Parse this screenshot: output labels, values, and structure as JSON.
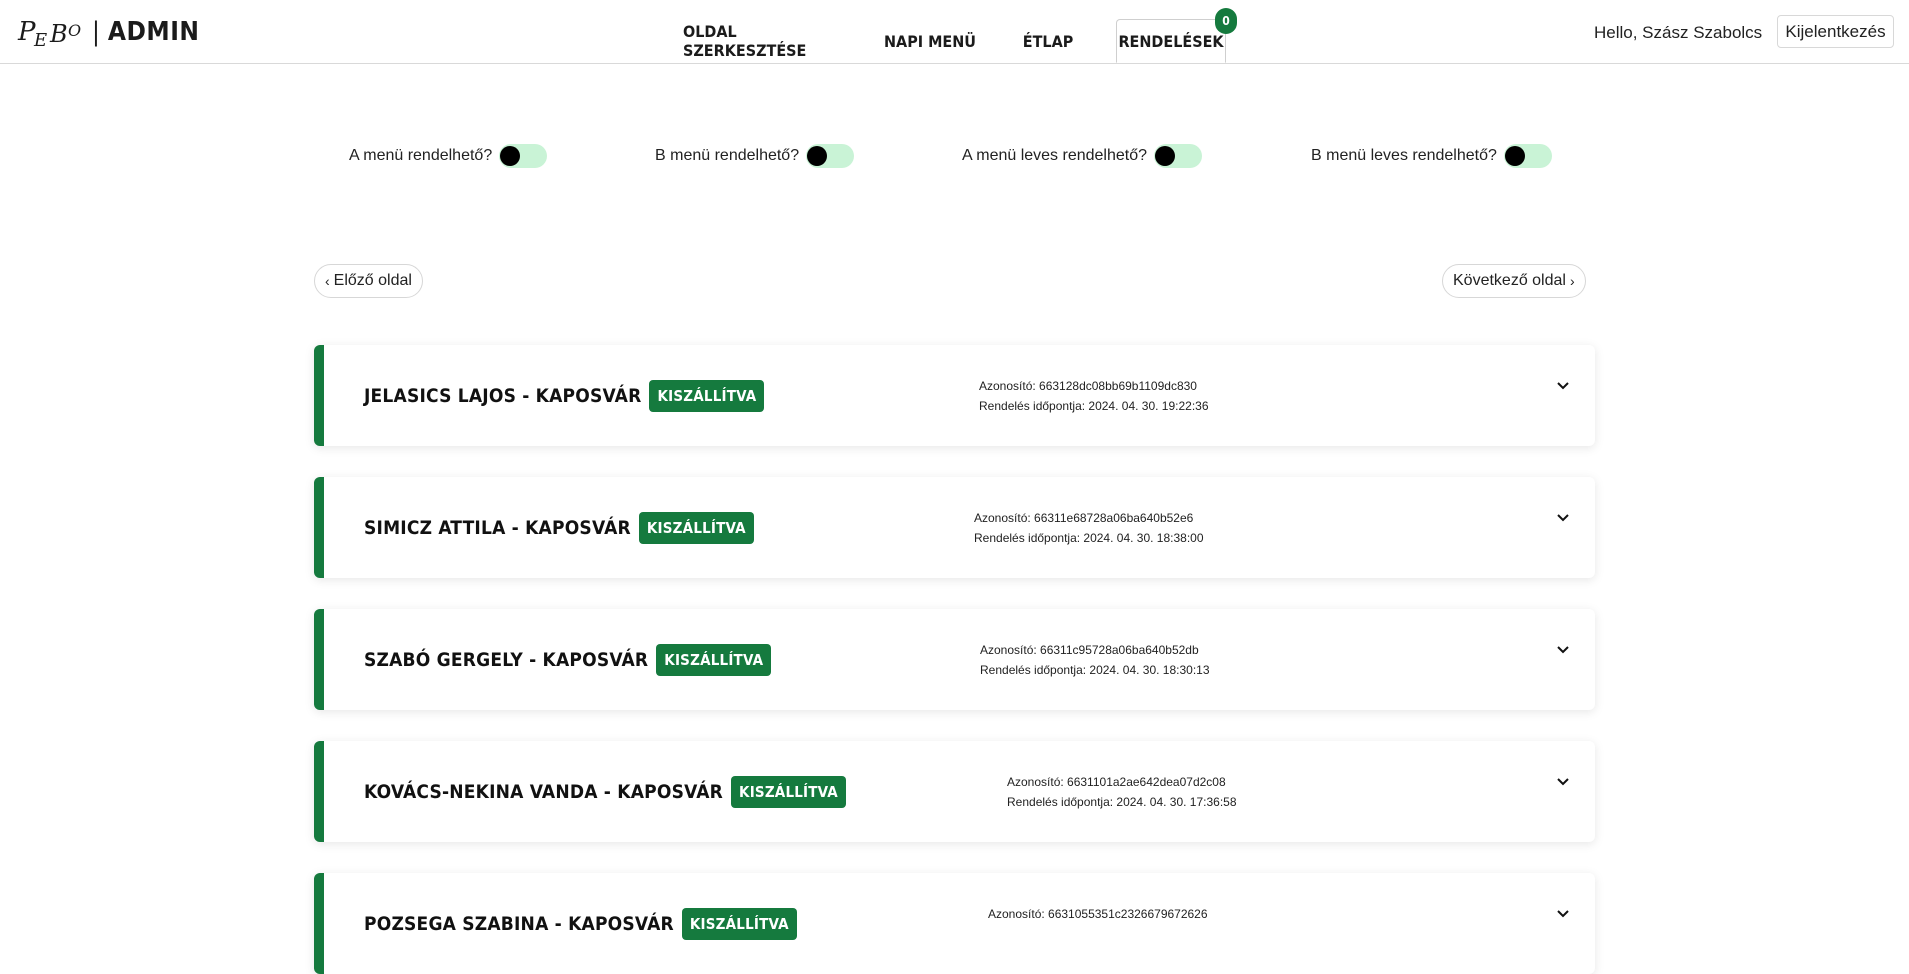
{
  "brand": {
    "logo_text": "PEBO",
    "separator": "|",
    "admin": "ADMIN"
  },
  "nav": {
    "tabs": [
      {
        "label": "OLDAL SZERKESZTÉSE"
      },
      {
        "label": "NAPI MENÜ"
      },
      {
        "label": "ÉTLAP"
      },
      {
        "label": "RENDELÉSEK",
        "active": true
      }
    ],
    "orders_badge": "0"
  },
  "user": {
    "greeting": "Hello, Szász Szabolcs",
    "logout_label": "Kijelentkezés"
  },
  "toggles": [
    {
      "label": "A menü rendelhető?",
      "on": false
    },
    {
      "label": "B menü rendelhető?",
      "on": false
    },
    {
      "label": "A menü leves rendelhető?",
      "on": false
    },
    {
      "label": "B menü leves rendelhető?",
      "on": false
    }
  ],
  "pagination": {
    "prev_label": "Előző oldal",
    "next_label": "Következő oldal"
  },
  "orders": [
    {
      "title": "JELASICS LAJOS - KAPOSVÁR",
      "status": "KISZÁLLÍTVA",
      "id_line": "Azonosító: 663128dc08bb69b1109dc830",
      "time_line": "Rendelés időpontja: 2024. 04. 30. 19:22:36"
    },
    {
      "title": "SIMICZ ATTILA - KAPOSVÁR",
      "status": "KISZÁLLÍTVA",
      "id_line": "Azonosító: 66311e68728a06ba640b52e6",
      "time_line": "Rendelés időpontja: 2024. 04. 30. 18:38:00"
    },
    {
      "title": "SZABÓ GERGELY - KAPOSVÁR",
      "status": "KISZÁLLÍTVA",
      "id_line": "Azonosító: 66311c95728a06ba640b52db",
      "time_line": "Rendelés időpontja: 2024. 04. 30. 18:30:13"
    },
    {
      "title": "KOVÁCS-NEKINA VANDA - KAPOSVÁR",
      "status": "KISZÁLLÍTVA",
      "id_line": "Azonosító: 6631101a2ae642dea07d2c08",
      "time_line": "Rendelés időpontja: 2024. 04. 30. 17:36:58"
    },
    {
      "title": "POZSEGA SZABINA - KAPOSVÁR",
      "status": "KISZÁLLÍTVA",
      "id_line": "Azonosító: 6631055351c2326679672626",
      "time_line": ""
    }
  ],
  "colors": {
    "accent": "#157a3e",
    "toggle_track": "#c9f3d6",
    "toggle_knob": "#000000"
  },
  "icons": {
    "expand": "chevron-down-icon",
    "prev": "chevron-left-icon",
    "next": "chevron-right-icon"
  }
}
